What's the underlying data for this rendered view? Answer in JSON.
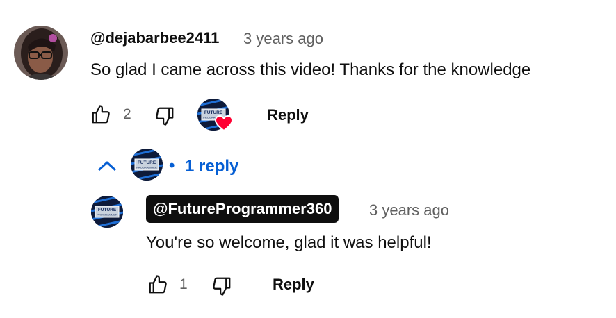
{
  "comment": {
    "author": "@dejabarbee2411",
    "time": "3 years ago",
    "text": "So glad I came across this video! Thanks for the knowledge",
    "likes": "2",
    "reply_label": "Reply",
    "creator_heart": true
  },
  "replies_toggle": {
    "separator": "•",
    "label": "1 reply",
    "expanded": true
  },
  "reply": {
    "author": "@FutureProgrammer360",
    "time": "3 years ago",
    "text": "You're so welcome, glad it was helpful!",
    "likes": "1",
    "reply_label": "Reply"
  },
  "avatar_text": {
    "line1": "FUTURE",
    "line2": "PROGRAMMER"
  },
  "colors": {
    "link_blue": "#065fd4",
    "heart_red": "#ff0033",
    "muted": "#606060",
    "text": "#0f0f0f"
  },
  "icons": [
    "thumbs-up-icon",
    "thumbs-down-icon",
    "chevron-up-icon",
    "heart-icon"
  ]
}
